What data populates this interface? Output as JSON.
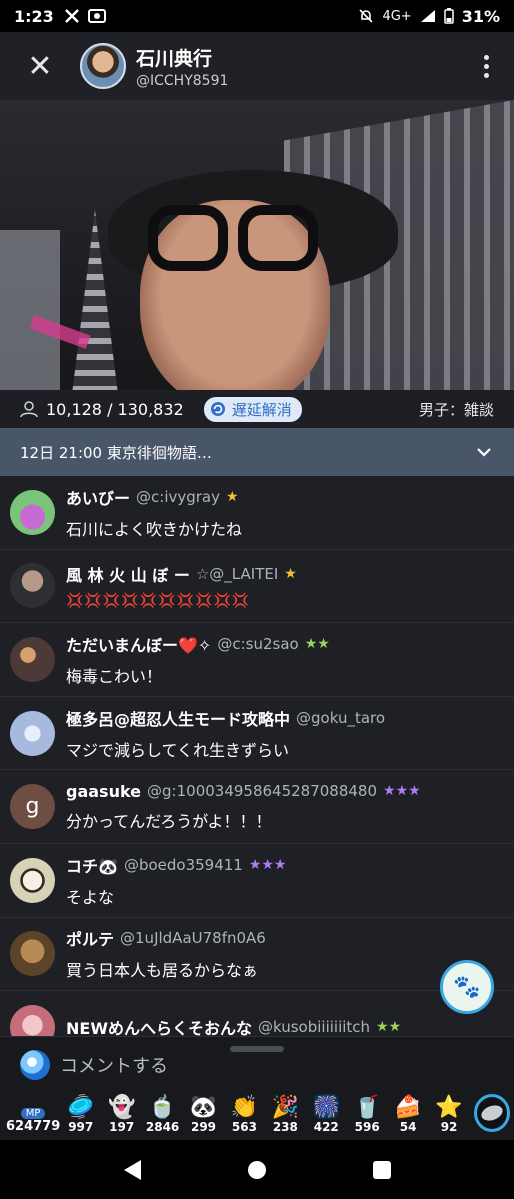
{
  "status_bar": {
    "time": "1:23",
    "network": "4G+",
    "battery": "31%"
  },
  "header": {
    "name": "石川典行",
    "handle": "@ICCHY8591"
  },
  "stats": {
    "viewers": "10,128 / 130,832",
    "delay_label": "遅延解消",
    "category": "男子：雑談"
  },
  "schedule": {
    "text": "12日 21:00 東京徘徊物語…"
  },
  "comments": [
    {
      "name": "あいびー",
      "handle": "@c:ivygray",
      "text": "石川によく吹きかけたね",
      "badges": "★",
      "avatar_color": "#7bc57a"
    },
    {
      "name": "風 林 火 山 ぼ ー",
      "handle": "☆@_LAITEI",
      "text": "💢💢💢💢💢💢💢💢💢💢",
      "badges": "★",
      "avatar_color": "#5c5750"
    },
    {
      "name": "ただいまんぼー❤️✧",
      "handle": "@c:su2sao",
      "text": "梅毒こわい！",
      "badges": "★★",
      "avatar_color": "#4b3a36"
    },
    {
      "name": "極多呂@超忍人生モード攻略中",
      "handle": "@goku_taro",
      "text": "マジで減らしてくれ生きずらい",
      "badges": "",
      "avatar_color": "#a7b9dc"
    },
    {
      "name": "gaasuke",
      "handle": "@g:100034958645287088480",
      "text": "分かってんだろうがよ！！！",
      "badges": "★★★",
      "avatar_color": "#6e4d42",
      "avatar_letter": "g"
    },
    {
      "name": "コチ🐼",
      "handle": "@boedo359411",
      "text": "そよな",
      "badges": "★★★",
      "avatar_color": "#d7d1b6"
    },
    {
      "name": "ポルテ",
      "handle": "@1uJldAaU78fn0A6",
      "text": "買う日本人も居るからなぁ",
      "badges": "",
      "avatar_color": "#8a6a3e"
    },
    {
      "name": "NEWめんへらくそおんな",
      "handle": "@kusobiiiiiiitch",
      "text": "",
      "badges": "★★",
      "avatar_color": "#c46e7a"
    }
  ],
  "input": {
    "placeholder": "コメントする"
  },
  "mp": {
    "tag": "MP",
    "value": "624779"
  },
  "gifts": [
    {
      "icon": "🥏",
      "count": "997"
    },
    {
      "icon": "👻",
      "count": "197"
    },
    {
      "icon": "🍵",
      "count": "2846"
    },
    {
      "icon": "🐼",
      "count": "299"
    },
    {
      "icon": "👏",
      "count": "563"
    },
    {
      "icon": "🎉",
      "count": "238"
    },
    {
      "icon": "🎆",
      "count": "422"
    },
    {
      "icon": "🥤",
      "count": "596"
    },
    {
      "icon": "🍰",
      "count": "54"
    },
    {
      "icon": "⭐",
      "count": "92"
    }
  ],
  "float_button": {
    "icon": "🐾"
  }
}
